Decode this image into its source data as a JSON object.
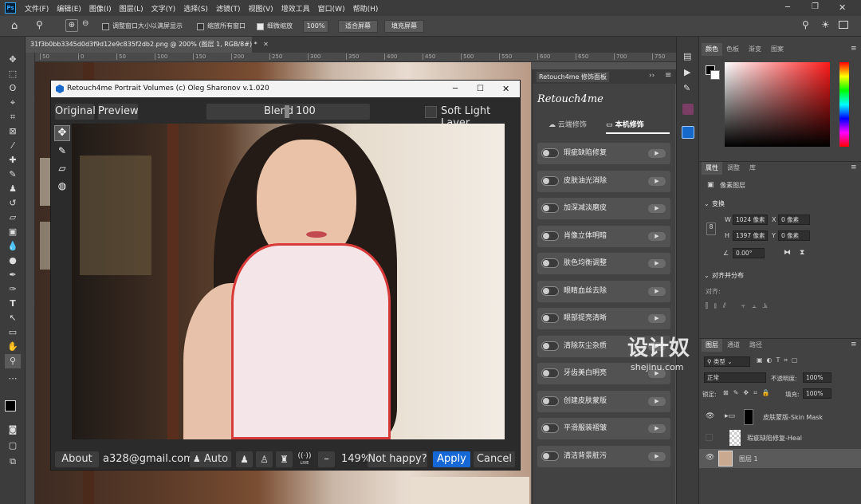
{
  "menu": [
    "文件(F)",
    "编辑(E)",
    "图像(I)",
    "图层(L)",
    "文字(Y)",
    "选择(S)",
    "滤镜(T)",
    "视图(V)",
    "增效工具",
    "窗口(W)",
    "帮助(H)"
  ],
  "options": {
    "resize_windows": "调整窗口大小以满屏显示",
    "zoom_all": "缩放所有窗口",
    "scrubby_zoom": "细微缩放",
    "zoom_value": "100%",
    "fit_screen": "适合屏幕",
    "fill_screen": "填充屏幕"
  },
  "document": {
    "tab_title": "31f3b0bb3345d0d3f9d12e9c835f2db2.png @ 200% (图层 1, RGB/8#) *",
    "ruler_ticks": [
      "50",
      "0",
      "50",
      "100",
      "150",
      "200",
      "250",
      "300",
      "350",
      "400",
      "450",
      "500",
      "550",
      "600",
      "650",
      "700",
      "750"
    ]
  },
  "plugin": {
    "title": "Retouch4me Portrait Volumes (c) Oleg Sharonov v.1.020",
    "original": "Original",
    "preview": "Preview",
    "blend_label": "Blend",
    "blend_value": "100",
    "soft_light": "Soft Light Layer",
    "about": "About",
    "email": "a328@gmail.com",
    "auto": "Auto",
    "minus": "–",
    "zoom": "149%",
    "not_happy": "Not happy?",
    "apply": "Apply",
    "cancel": "Cancel",
    "live": "LIVE"
  },
  "retouch": {
    "panel_title": "Retouch4me 修饰面板",
    "logo": "Retouch4me",
    "tab_cloud": "云端修饰",
    "tab_local": "本机修饰",
    "items": [
      "瑕疵缺陷修复",
      "皮肤油光消除",
      "加深减淡磨皮",
      "肖像立体明暗",
      "肤色均衡调整",
      "眼睛血丝去除",
      "眼部提亮清晰",
      "清除灰尘杂质",
      "牙齿美白明亮",
      "创建皮肤蒙版",
      "平滑服装褶皱",
      "清洁背景脏污"
    ]
  },
  "panels": {
    "color_tabs": [
      "颜色",
      "色板",
      "渐变",
      "图案"
    ],
    "props_tabs": [
      "属性",
      "调整",
      "库"
    ],
    "pixel_layer": "像素图层",
    "transform": "变换",
    "w_label": "W",
    "w_value": "1024 像素",
    "h_label": "H",
    "h_value": "1397 像素",
    "x_label": "X",
    "x_value": "0 像素",
    "y_label": "Y",
    "y_value": "0 像素",
    "angle": "0.00°",
    "align": "对齐并分布",
    "align_sub": "对齐:",
    "layers_tabs": [
      "图层",
      "通道",
      "路径"
    ],
    "kind": "类型",
    "blend_mode": "正常",
    "opacity_label": "不透明度:",
    "opacity": "100%",
    "lock_label": "锁定:",
    "fill_label": "填充:",
    "fill": "100%",
    "layers": [
      "皮肤蒙版-Skin Mask",
      "瑕疵缺陷修复-Heal",
      "图层 1"
    ]
  },
  "watermark": {
    "main": "设计奴",
    "sub": "shejinu.com"
  }
}
